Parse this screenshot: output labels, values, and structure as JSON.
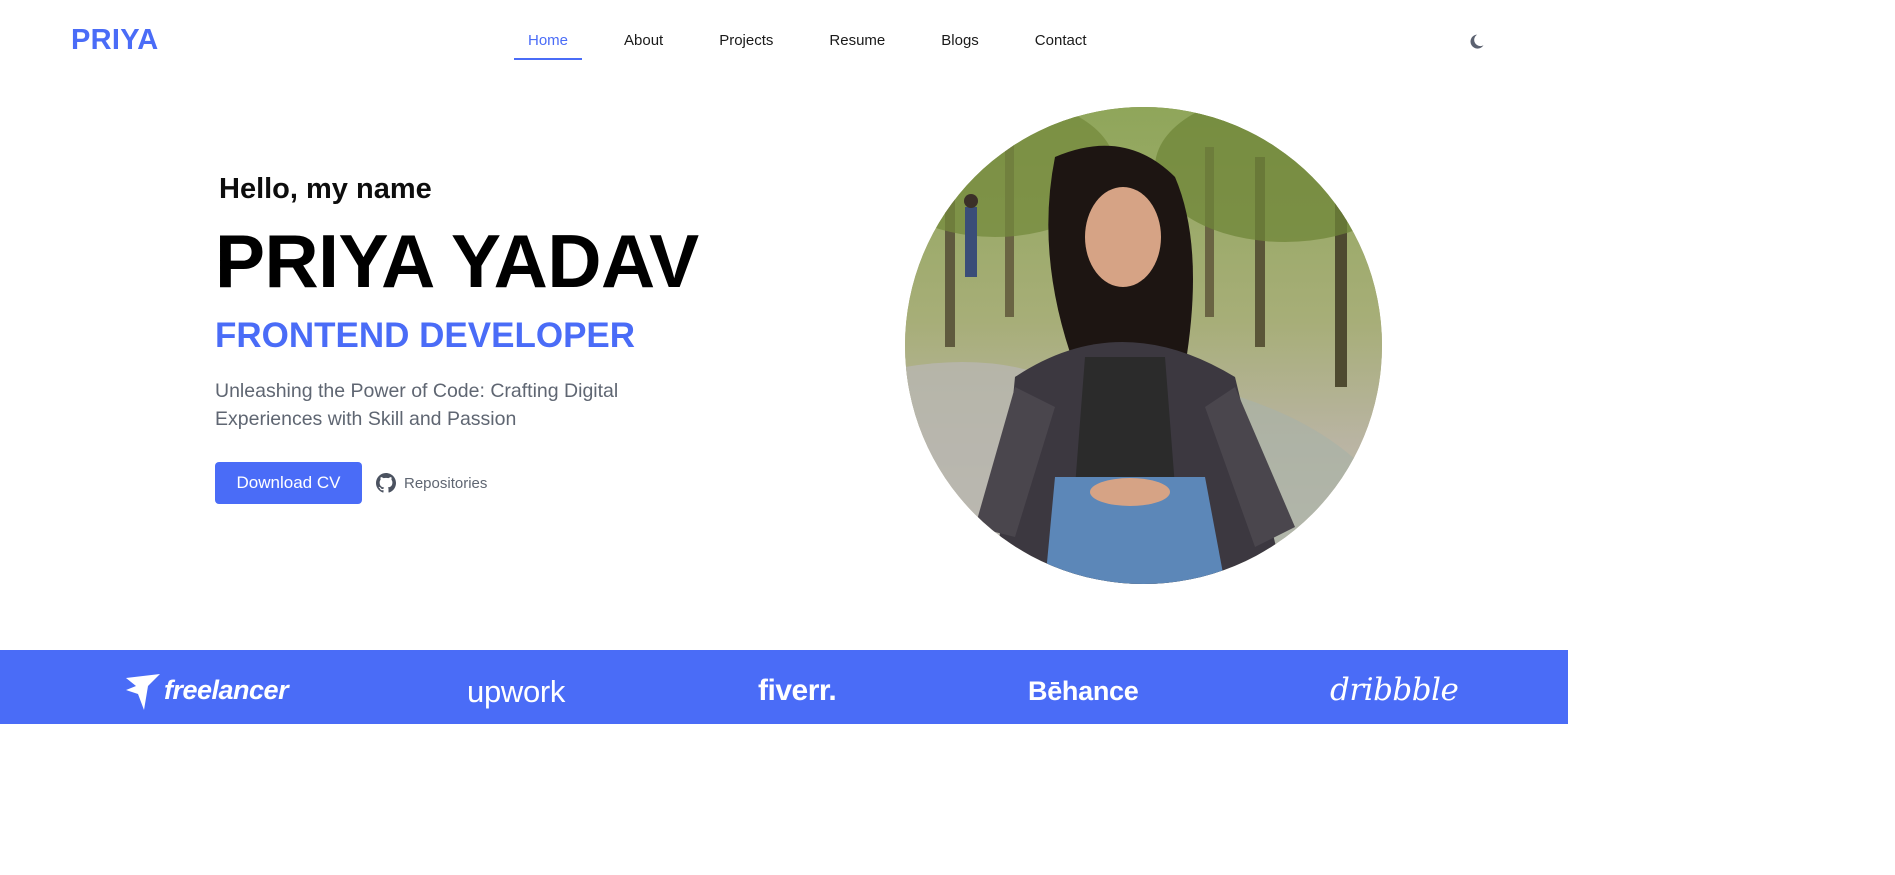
{
  "brand": {
    "logo": "PRIYA",
    "accent_color": "#4a6cf7"
  },
  "nav": {
    "items": [
      {
        "label": "Home",
        "active": true
      },
      {
        "label": "About",
        "active": false
      },
      {
        "label": "Projects",
        "active": false
      },
      {
        "label": "Resume",
        "active": false
      },
      {
        "label": "Blogs",
        "active": false
      },
      {
        "label": "Contact",
        "active": false
      }
    ],
    "theme_toggle_icon": "moon-icon"
  },
  "hero": {
    "greeting": "Hello, my name",
    "name": "PRIYA YADAV",
    "role": "FRONTEND DEVELOPER",
    "tagline": "Unleashing the Power of Code: Crafting Digital Experiences with Skill and Passion",
    "download_cv_label": "Download CV",
    "repositories_label": "Repositories",
    "repositories_icon": "github-icon",
    "photo_icon": "profile-photo"
  },
  "partners": {
    "background_color": "#4a6cf7",
    "items": [
      {
        "label": "freelancer",
        "icon": "freelancer-logo"
      },
      {
        "label": "upwork",
        "icon": "upwork-logo"
      },
      {
        "label": "fiverr.",
        "icon": "fiverr-logo"
      },
      {
        "label": "Bēhance",
        "icon": "behance-logo"
      },
      {
        "label": "dribbble",
        "icon": "dribbble-logo"
      }
    ]
  }
}
